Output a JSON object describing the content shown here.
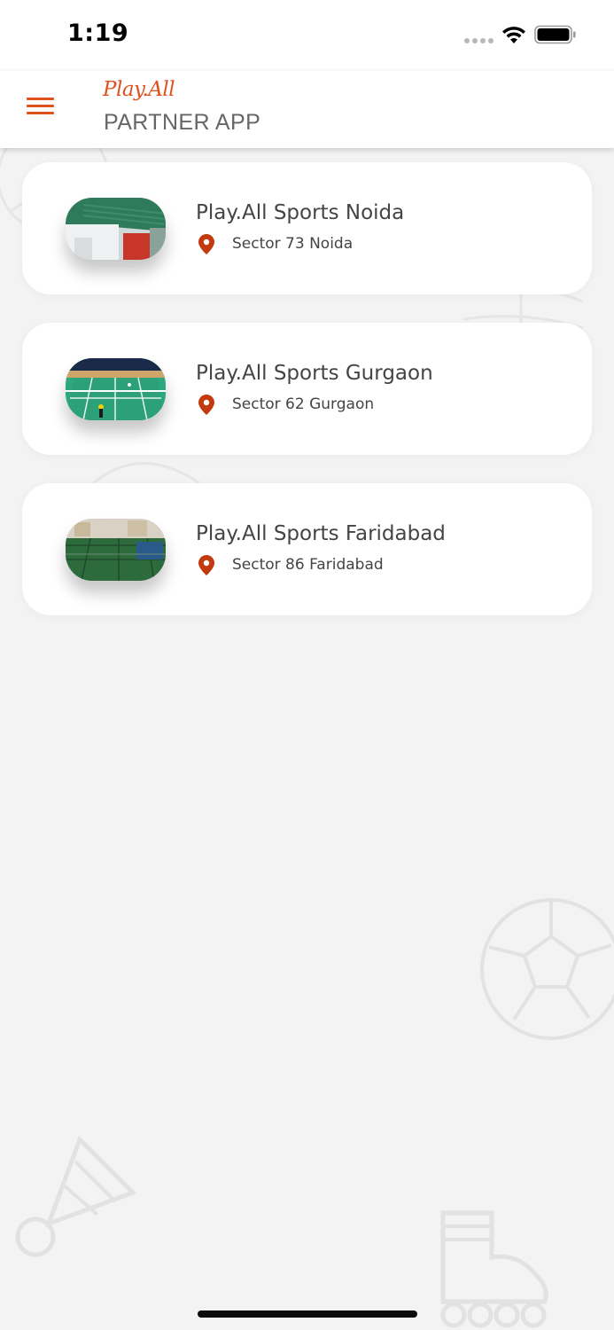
{
  "status_bar": {
    "time": "1:19"
  },
  "header": {
    "brand": "Play.All",
    "subtitle": "PARTNER APP",
    "menu_icon": "hamburger-menu-icon",
    "accent_color": "#e0521d"
  },
  "venues": [
    {
      "name": "Play.All Sports Noida",
      "address": "Sector 73 Noida",
      "thumbnail": "indoor-facility-exterior"
    },
    {
      "name": "Play.All Sports Gurgaon",
      "address": "Sector 62 Gurgaon",
      "thumbnail": "badminton-court"
    },
    {
      "name": "Play.All Sports Faridabad",
      "address": "Sector 86 Faridabad",
      "thumbnail": "outdoor-turf"
    }
  ],
  "icons": {
    "location": "map-pin-icon",
    "pin_color": "#c23b0e"
  }
}
